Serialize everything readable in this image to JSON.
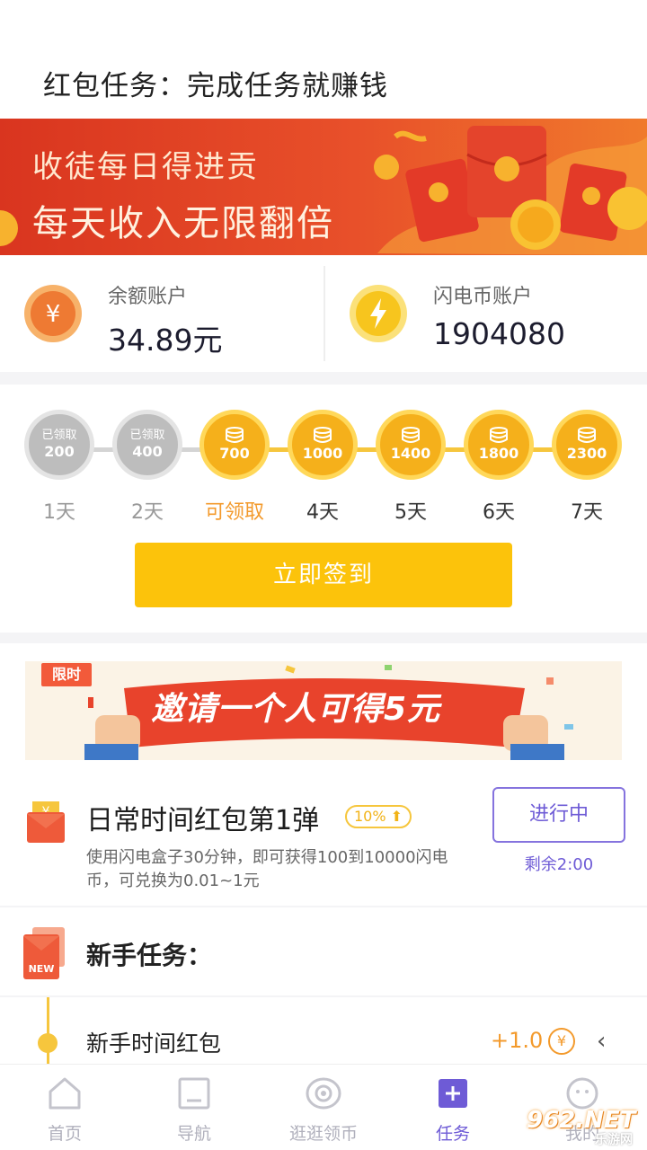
{
  "header": {
    "title": "红包任务：完成任务就赚钱"
  },
  "banner": {
    "line1": "收徒每日得进贡",
    "line2": "每天收入无限翻倍"
  },
  "accounts": {
    "balance": {
      "label": "余额账户",
      "value": "34.89元"
    },
    "coins": {
      "label": "闪电币账户",
      "value": "1904080"
    }
  },
  "signin": {
    "days": [
      {
        "tag": "已领取",
        "amount": "200",
        "label": "1天",
        "state": "claimed"
      },
      {
        "tag": "已领取",
        "amount": "400",
        "label": "2天",
        "state": "claimed"
      },
      {
        "tag": "",
        "amount": "700",
        "label": "可领取",
        "state": "available"
      },
      {
        "tag": "",
        "amount": "1000",
        "label": "4天",
        "state": "future"
      },
      {
        "tag": "",
        "amount": "1400",
        "label": "5天",
        "state": "future"
      },
      {
        "tag": "",
        "amount": "1800",
        "label": "6天",
        "state": "future"
      },
      {
        "tag": "",
        "amount": "2300",
        "label": "7天",
        "state": "future"
      }
    ],
    "button": "立即签到"
  },
  "invite": {
    "tag": "限时",
    "text": "邀请一个人可得5元"
  },
  "daily_task": {
    "name": "日常时间红包第1弹",
    "percent": "10%",
    "description": "使用闪电盒子30分钟，即可获得100到10000闪电币，可兑换为0.01~1元",
    "button": "进行中",
    "remaining": "剩余2:00"
  },
  "newbie": {
    "title": "新手任务：",
    "badge": "NEW",
    "item": {
      "name": "新手时间红包",
      "reward": "+1.0",
      "currency_symbol": "¥",
      "chevron": "‹"
    }
  },
  "tabs": [
    {
      "label": "首页",
      "icon": "home-icon"
    },
    {
      "label": "导航",
      "icon": "navigation-icon"
    },
    {
      "label": "逛逛领币",
      "icon": "eye-icon"
    },
    {
      "label": "任务",
      "icon": "task-icon",
      "active": true
    },
    {
      "label": "我的",
      "icon": "profile-icon"
    }
  ],
  "watermark": {
    "brand": "962.NET",
    "site": "乐游网"
  },
  "colors": {
    "accent": "#6e5bd6",
    "gold": "#f6c63d",
    "button": "#fcc30b",
    "banner": "#e8502a",
    "orange": "#f39a2c"
  }
}
